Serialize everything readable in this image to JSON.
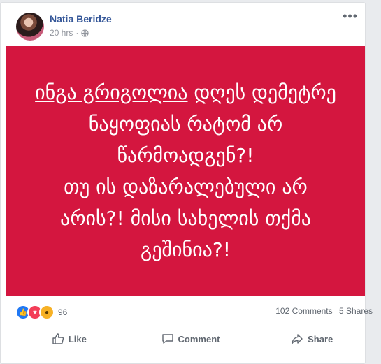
{
  "post": {
    "author": "Natia Beridze",
    "time": "20 hrs",
    "more": "•••"
  },
  "banner": {
    "background": "#d4163f",
    "underlined": "ინგა გრიგოლია",
    "line1_rest": " დღეს დემეტრე",
    "line2": "ნაყოფიას რატომ არ",
    "line3": "წარმოადგენ?!",
    "line4": "თუ ის დაზარალებული არ",
    "line5": "არის?! მისი სახელის თქმა",
    "line6": "გეშინია?!"
  },
  "stats": {
    "reaction_count": "96",
    "comments": "102 Comments",
    "shares": "5 Shares",
    "reactions": [
      "like-icon",
      "love-icon",
      "wow-icon"
    ]
  },
  "actions": {
    "like": "Like",
    "comment": "Comment",
    "share": "Share"
  }
}
